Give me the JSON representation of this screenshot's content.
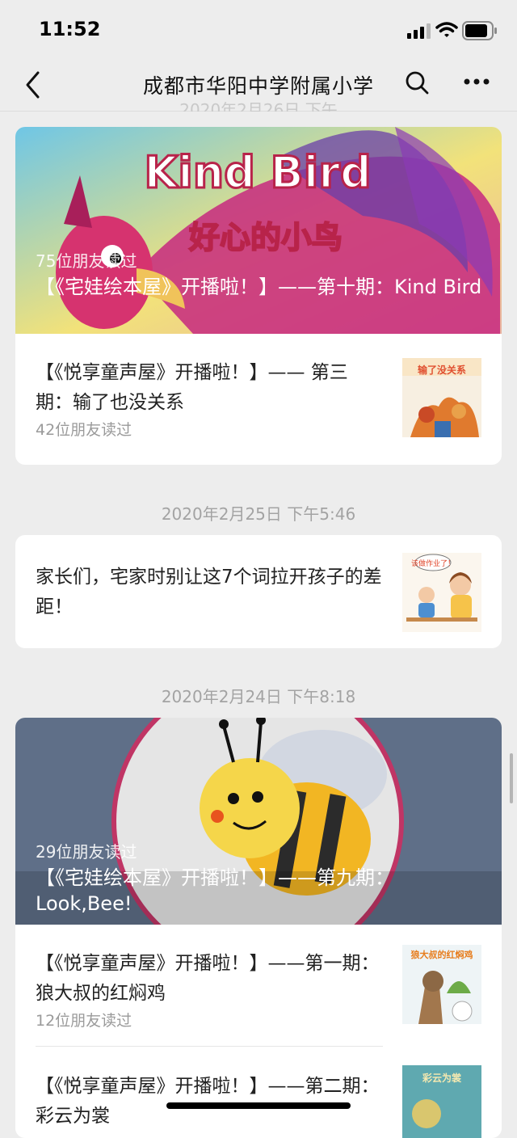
{
  "status": {
    "time": "11:52"
  },
  "nav": {
    "title": "成都市华阳中学附属小学"
  },
  "ghost": {
    "text": "2020年2月26日 下午"
  },
  "groups": [
    {
      "cover": {
        "reads": "75位朋友读过",
        "title": "【《宅娃绘本屋》开播啦！】——第十期：Kind Bird",
        "art_title": "Kind Bird",
        "art_subtitle": "好心的小鸟"
      },
      "items": [
        {
          "title": "【《悦享童声屋》开播啦！】—— 第三期：输了也没关系",
          "reads": "42位朋友读过",
          "thumb_text": "输了没关系"
        }
      ]
    },
    {
      "date": "2020年2月25日 下午5:46",
      "items": [
        {
          "title": "家长们，宅家时别让这7个词拉开孩子的差距！",
          "thumb_text": "该做作业了！"
        }
      ]
    },
    {
      "date": "2020年2月24日 下午8:18",
      "cover": {
        "reads": "29位朋友读过",
        "title": "【《宅娃绘本屋》开播啦！】——第九期：Look,Bee!"
      },
      "items": [
        {
          "title": "【《悦享童声屋》开播啦！】——第一期：狼大叔的红焖鸡",
          "reads": "12位朋友读过",
          "thumb_text": "狼大叔的红焖鸡"
        },
        {
          "title": "【《悦享童声屋》开播啦！】——第二期：彩云为裳",
          "thumb_text": "彩云为裳"
        }
      ]
    }
  ]
}
